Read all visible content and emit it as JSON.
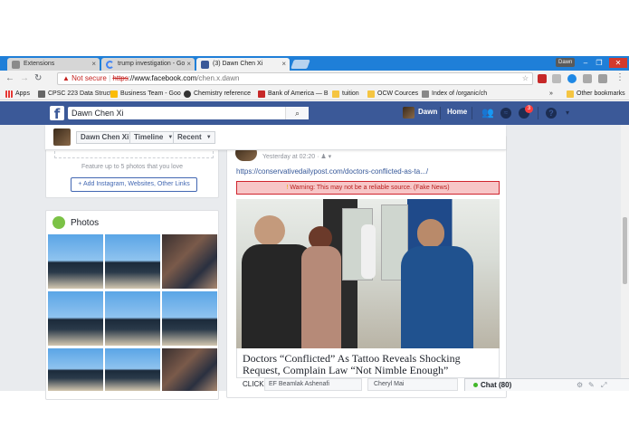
{
  "browser": {
    "tabs": [
      {
        "title": "Extensions"
      },
      {
        "title": "trump investigation - Go"
      },
      {
        "title": "(3) Dawn Chen Xi"
      }
    ],
    "profile_name": "Dawn",
    "omnibox": {
      "security_label": "Not secure",
      "scheme": "https",
      "host": "://www.facebook.com",
      "path": "/chen.x.dawn"
    },
    "bookmarks": [
      {
        "label": "Apps"
      },
      {
        "label": "CPSC 223 Data Struct"
      },
      {
        "label": "Business Team - Goo"
      },
      {
        "label": "Chemistry reference"
      },
      {
        "label": "Bank of America — B"
      },
      {
        "label": "tuition"
      },
      {
        "label": "OCW Cources"
      },
      {
        "label": "Index of /organic/ch"
      },
      {
        "label": "Other bookmarks"
      }
    ],
    "bookmarks_overflow": "»"
  },
  "facebook": {
    "logo": "f",
    "search_value": "Dawn Chen Xi",
    "user_name": "Dawn",
    "home_label": "Home",
    "notification_count": "3",
    "sticky": {
      "name_button": "Dawn Chen Xi",
      "timeline_button": "Timeline",
      "recent_button": "Recent"
    },
    "intro": {
      "feature_text": "Feature up to 5 photos that you love",
      "add_links": "+ Add Instagram, Websites, Other Links"
    },
    "photos": {
      "title": "Photos"
    },
    "post": {
      "timestamp": "Yesterday at 02:20 ·",
      "link_url": "https://conservativedailypost.com/doctors-conflicted-as-ta.../",
      "warning": "Warning: This may not be a reliable source. (Fake News)",
      "headline": "Doctors “Conflicted” As Tattoo Reveals Shocking Request, Complain Law “Not Nimble Enough”",
      "cta_partial": "CLICK"
    },
    "chat": {
      "label": "Chat (80)",
      "overlay_names": [
        "EF Beamlak Ashenafi",
        "Cheryl Mai"
      ]
    }
  },
  "colors": {
    "tabstrip": "#1f7fd8",
    "fb_blue": "#3b5998",
    "warning_bg": "#f7c6c7",
    "warning_border": "#d0242d"
  }
}
